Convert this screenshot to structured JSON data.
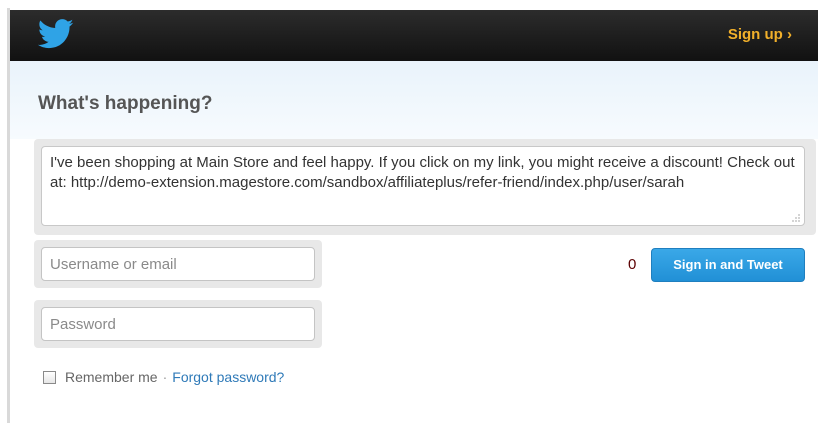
{
  "header": {
    "logo_icon": "twitter-bird-icon",
    "signup_label": "Sign up ›",
    "brand_color": "#2fa3e6",
    "signup_color": "#f2b02a"
  },
  "main": {
    "headline": "What's happening?",
    "tweet_text": "I've been shopping at Main Store and feel happy. If you click on my link, you might receive a discount! Check out at: http://demo-extension.magestore.com/sandbox/affiliateplus/refer-friend/index.php/user/sarah"
  },
  "login": {
    "username_placeholder": "Username or email",
    "username_value": "",
    "password_placeholder": "Password",
    "password_value": "",
    "remember_label": "Remember me",
    "separator": "·",
    "forgot_label": "Forgot password?",
    "remember_checked": false
  },
  "actions": {
    "char_count": "0",
    "submit_label": "Sign in and Tweet",
    "submit_color": "#2b9be0"
  }
}
